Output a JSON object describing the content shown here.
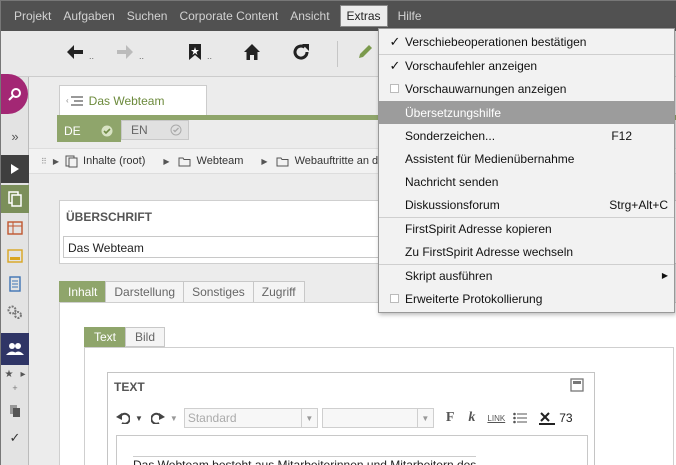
{
  "menubar": {
    "items": [
      "Projekt",
      "Aufgaben",
      "Suchen",
      "Corporate Content",
      "Ansicht",
      "Extras",
      "Hilfe"
    ],
    "active": "Extras"
  },
  "toolbar": {
    "back_dots": "..",
    "forward_dots": "..",
    "bookmark_dots": ".."
  },
  "doc_tab": {
    "label": "Das Webteam"
  },
  "languages": {
    "de": "DE",
    "en": "EN"
  },
  "breadcrumb": [
    "Inhalte (root)",
    "Webteam",
    "Webauftritte an d"
  ],
  "headline": {
    "title": "ÜBERSCHRIFT",
    "value": "Das Webteam"
  },
  "form_tabs": [
    "Inhalt",
    "Darstellung",
    "Sonstiges",
    "Zugriff"
  ],
  "sub_tabs": [
    "Text",
    "Bild"
  ],
  "editor": {
    "title": "TEXT",
    "style_select": "Standard",
    "link_label": "LINK",
    "char_count": "73",
    "content": "Das Webteam besteht aus Mitarbeiterinnen und Mitarbeitern des"
  },
  "extras_menu": {
    "items": [
      {
        "label": "Verschiebeoperationen bestätigen",
        "state": "checked"
      },
      {
        "label": "Vorschaufehler anzeigen",
        "state": "checked"
      },
      {
        "label": "Vorschauwarnungen anzeigen",
        "state": "unchecked"
      },
      {
        "label": "Übersetzungshilfe",
        "state": "highlighted"
      },
      {
        "label": "Sonderzeichen...",
        "shortcut": "F12"
      },
      {
        "label": "Assistent für Medienübernahme"
      },
      {
        "label": "Nachricht senden"
      },
      {
        "label": "Diskussionsforum",
        "shortcut": "Strg+Alt+C"
      },
      {
        "label": "FirstSpirit Adresse kopieren"
      },
      {
        "label": "Zu FirstSpirit Adresse wechseln"
      },
      {
        "label": "Skript ausführen",
        "submenu": true
      },
      {
        "label": "Erweiterte Protokollierung",
        "state": "unchecked"
      }
    ]
  },
  "colors": {
    "menubar": "#515151",
    "accent_green": "#8fa56b",
    "fab": "#a32774",
    "highlight": "#9c9c9c"
  }
}
